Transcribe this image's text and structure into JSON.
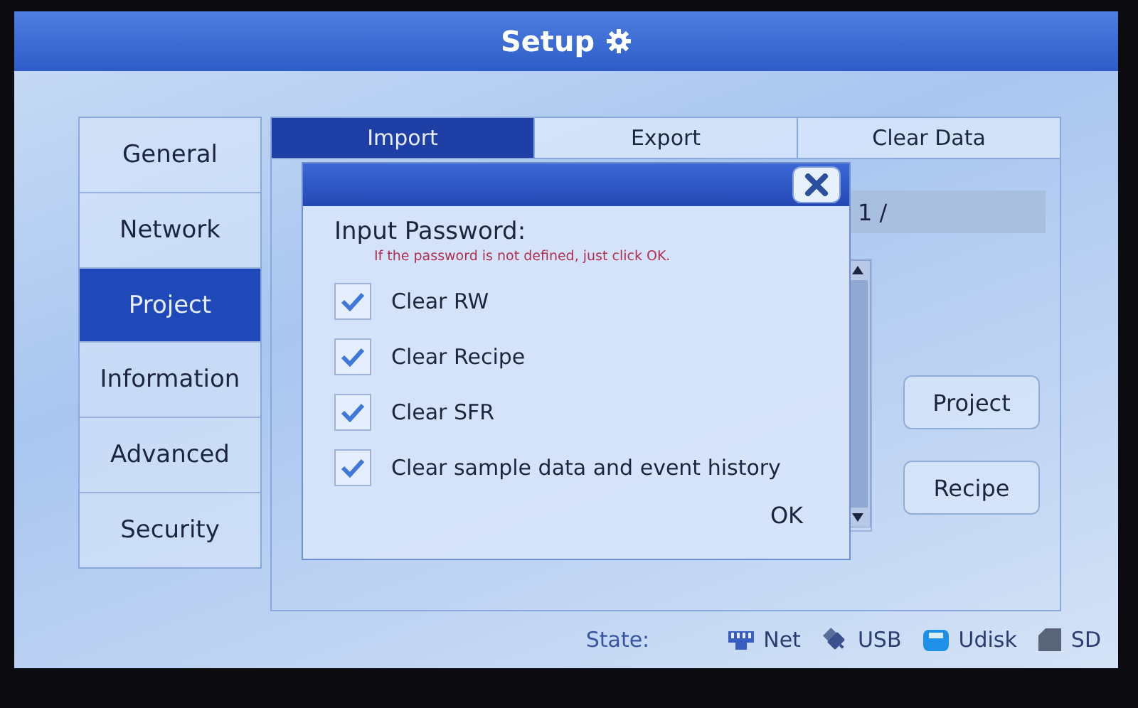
{
  "window": {
    "title": "Setup"
  },
  "sidebar": {
    "items": [
      {
        "label": "General",
        "selected": false
      },
      {
        "label": "Network",
        "selected": false
      },
      {
        "label": "Project",
        "selected": true
      },
      {
        "label": "Information",
        "selected": false
      },
      {
        "label": "Advanced",
        "selected": false
      },
      {
        "label": "Security",
        "selected": false
      }
    ]
  },
  "tabs": [
    {
      "label": "Import",
      "selected": true
    },
    {
      "label": "Export",
      "selected": false
    },
    {
      "label": "Clear Data",
      "selected": false
    }
  ],
  "page_field": {
    "value": "1 /"
  },
  "buttons": [
    "Project",
    "Recipe"
  ],
  "dialog": {
    "label": "Input Password:",
    "hint": "If the password is not defined, just click OK.",
    "options": [
      {
        "label": "Clear RW",
        "checked": true
      },
      {
        "label": "Clear Recipe",
        "checked": true
      },
      {
        "label": "Clear SFR",
        "checked": true
      },
      {
        "label": "Clear sample data and event history",
        "checked": true
      }
    ],
    "ok_button": "OK"
  },
  "status_bar": {
    "label": "State:",
    "items": [
      {
        "kind": "net",
        "label": "Net"
      },
      {
        "kind": "usb",
        "label": "USB"
      },
      {
        "kind": "udisk",
        "label": "Udisk"
      },
      {
        "kind": "sd",
        "label": "SD"
      }
    ]
  }
}
